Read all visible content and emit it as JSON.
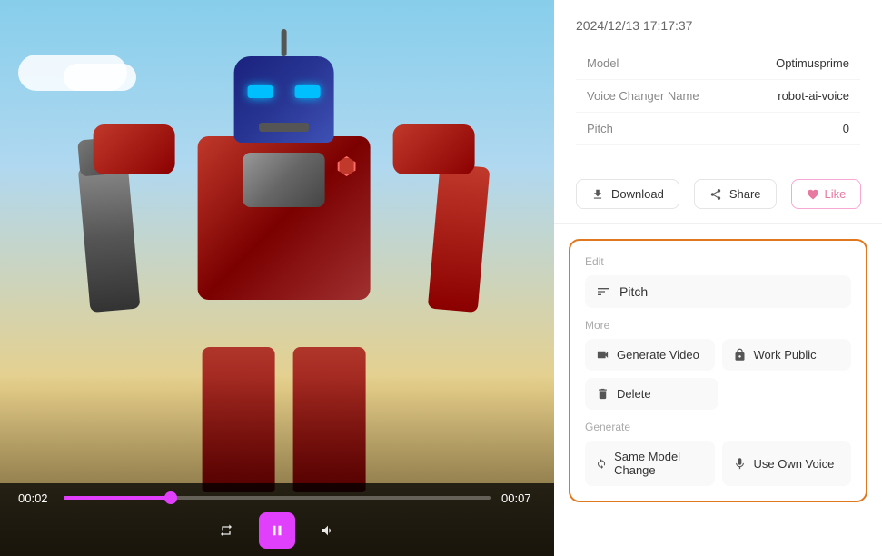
{
  "timestamp": "2024/12/13 17:17:37",
  "info": {
    "rows": [
      {
        "label": "Model",
        "value": "Optimusprime"
      },
      {
        "label": "Voice Changer Name",
        "value": "robot-ai-voice"
      },
      {
        "label": "Pitch",
        "value": "0"
      }
    ]
  },
  "actions": {
    "download": "Download",
    "share": "Share",
    "like": "Like"
  },
  "player": {
    "current_time": "00:02",
    "total_time": "00:07",
    "progress_percent": 25
  },
  "edit_section": {
    "edit_label": "Edit",
    "pitch_label": "Pitch"
  },
  "more_section": {
    "more_label": "More",
    "generate_video": "Generate Video",
    "work_public": "Work Public",
    "delete": "Delete"
  },
  "generate_section": {
    "generate_label": "Generate",
    "same_model_change": "Same Model Change",
    "use_own_voice": "Use Own Voice"
  }
}
